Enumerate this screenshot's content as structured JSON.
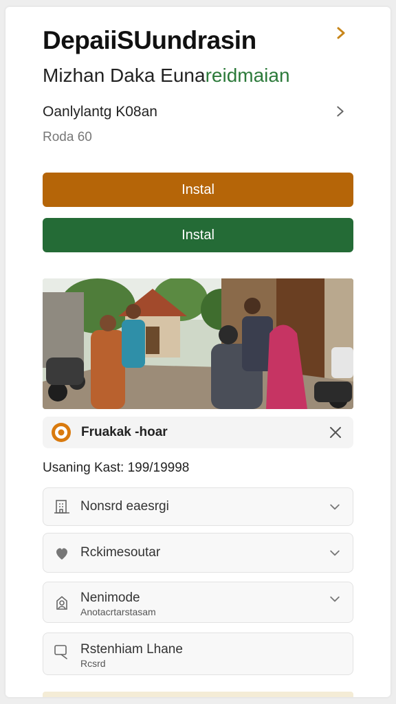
{
  "header": {
    "title": "DepaiiSUundrasin",
    "subtitle_main": "Mizhan Daka Euna",
    "subtitle_accent": "reidmaian"
  },
  "detail_row": {
    "label": "Oanlylantg K08an",
    "sub": "Roda 60"
  },
  "buttons": {
    "primary_label": "Instal",
    "secondary_label": "Instal"
  },
  "photo": {
    "icon": "village-photo"
  },
  "info_bar": {
    "text": "Fruakak -hoar"
  },
  "meta": {
    "text": "Usaning Kast: 199/19998"
  },
  "list": [
    {
      "label": "Nonsrd eaesrgi",
      "sub": ""
    },
    {
      "label": "Rckimesoutar",
      "sub": ""
    },
    {
      "label": "Nenimode",
      "sub": "Anotacrtarstasam"
    },
    {
      "label": "Rstenhiam Lhane",
      "sub": "Rcsrd"
    }
  ],
  "colors": {
    "primary": "#b56508",
    "secondary": "#246b36",
    "accent_text": "#2c7a3a"
  }
}
